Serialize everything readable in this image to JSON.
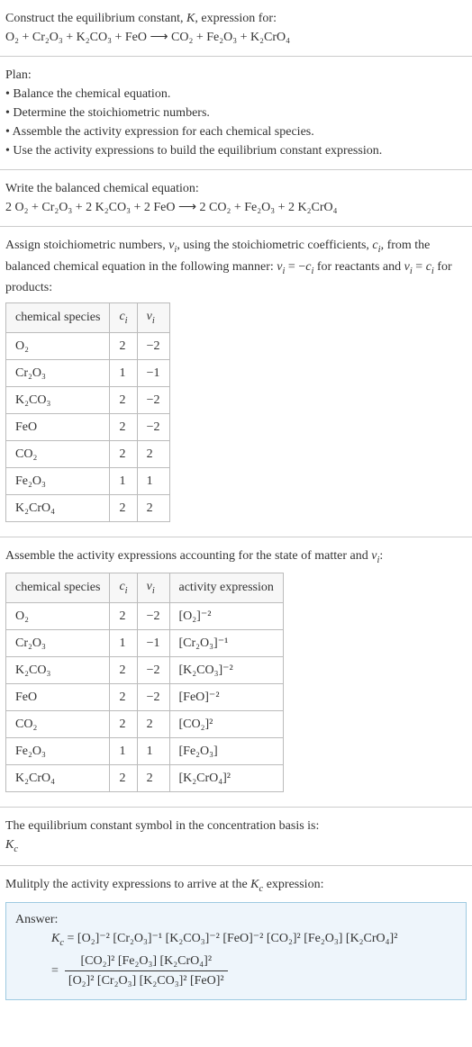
{
  "prompt": {
    "line1": "Construct the equilibrium constant, K, expression for:",
    "equation": "O₂ + Cr₂O₃ + K₂CO₃ + FeO ⟶ CO₂ + Fe₂O₃ + K₂CrO₄"
  },
  "plan": {
    "title": "Plan:",
    "items": [
      "Balance the chemical equation.",
      "Determine the stoichiometric numbers.",
      "Assemble the activity expression for each chemical species.",
      "Use the activity expressions to build the equilibrium constant expression."
    ]
  },
  "balanced": {
    "title": "Write the balanced chemical equation:",
    "equation": "2 O₂ + Cr₂O₃ + 2 K₂CO₃ + 2 FeO ⟶ 2 CO₂ + Fe₂O₃ + 2 K₂CrO₄"
  },
  "assign": {
    "text": "Assign stoichiometric numbers, νᵢ, using the stoichiometric coefficients, cᵢ, from the balanced chemical equation in the following manner: νᵢ = −cᵢ for reactants and νᵢ = cᵢ for products:",
    "headers": [
      "chemical species",
      "cᵢ",
      "νᵢ"
    ],
    "rows": [
      {
        "species": "O₂",
        "c": "2",
        "v": "−2"
      },
      {
        "species": "Cr₂O₃",
        "c": "1",
        "v": "−1"
      },
      {
        "species": "K₂CO₃",
        "c": "2",
        "v": "−2"
      },
      {
        "species": "FeO",
        "c": "2",
        "v": "−2"
      },
      {
        "species": "CO₂",
        "c": "2",
        "v": "2"
      },
      {
        "species": "Fe₂O₃",
        "c": "1",
        "v": "1"
      },
      {
        "species": "K₂CrO₄",
        "c": "2",
        "v": "2"
      }
    ]
  },
  "activity": {
    "title": "Assemble the activity expressions accounting for the state of matter and νᵢ:",
    "headers": [
      "chemical species",
      "cᵢ",
      "νᵢ",
      "activity expression"
    ],
    "rows": [
      {
        "species": "O₂",
        "c": "2",
        "v": "−2",
        "expr": "[O₂]⁻²"
      },
      {
        "species": "Cr₂O₃",
        "c": "1",
        "v": "−1",
        "expr": "[Cr₂O₃]⁻¹"
      },
      {
        "species": "K₂CO₃",
        "c": "2",
        "v": "−2",
        "expr": "[K₂CO₃]⁻²"
      },
      {
        "species": "FeO",
        "c": "2",
        "v": "−2",
        "expr": "[FeO]⁻²"
      },
      {
        "species": "CO₂",
        "c": "2",
        "v": "2",
        "expr": "[CO₂]²"
      },
      {
        "species": "Fe₂O₃",
        "c": "1",
        "v": "1",
        "expr": "[Fe₂O₃]"
      },
      {
        "species": "K₂CrO₄",
        "c": "2",
        "v": "2",
        "expr": "[K₂CrO₄]²"
      }
    ]
  },
  "symbol": {
    "line1": "The equilibrium constant symbol in the concentration basis is:",
    "line2": "K_c"
  },
  "multiply": {
    "title": "Mulitply the activity expressions to arrive at the K_c expression:"
  },
  "answer": {
    "label": "Answer:",
    "lhs": "K_c = ",
    "flat": "[O₂]⁻² [Cr₂O₃]⁻¹ [K₂CO₃]⁻² [FeO]⁻² [CO₂]² [Fe₂O₃] [K₂CrO₄]²",
    "num": "[CO₂]² [Fe₂O₃] [K₂CrO₄]²",
    "den": "[O₂]² [Cr₂O₃] [K₂CO₃]² [FeO]²"
  },
  "chart_data": {
    "type": "table",
    "tables": [
      {
        "headers": [
          "chemical species",
          "c_i",
          "ν_i"
        ],
        "rows": [
          [
            "O2",
            2,
            -2
          ],
          [
            "Cr2O3",
            1,
            -1
          ],
          [
            "K2CO3",
            2,
            -2
          ],
          [
            "FeO",
            2,
            -2
          ],
          [
            "CO2",
            2,
            2
          ],
          [
            "Fe2O3",
            1,
            1
          ],
          [
            "K2CrO4",
            2,
            2
          ]
        ]
      },
      {
        "headers": [
          "chemical species",
          "c_i",
          "ν_i",
          "activity expression"
        ],
        "rows": [
          [
            "O2",
            2,
            -2,
            "[O2]^-2"
          ],
          [
            "Cr2O3",
            1,
            -1,
            "[Cr2O3]^-1"
          ],
          [
            "K2CO3",
            2,
            -2,
            "[K2CO3]^-2"
          ],
          [
            "FeO",
            2,
            -2,
            "[FeO]^-2"
          ],
          [
            "CO2",
            2,
            2,
            "[CO2]^2"
          ],
          [
            "Fe2O3",
            1,
            1,
            "[Fe2O3]"
          ],
          [
            "K2CrO4",
            2,
            2,
            "[K2CrO4]^2"
          ]
        ]
      }
    ]
  }
}
